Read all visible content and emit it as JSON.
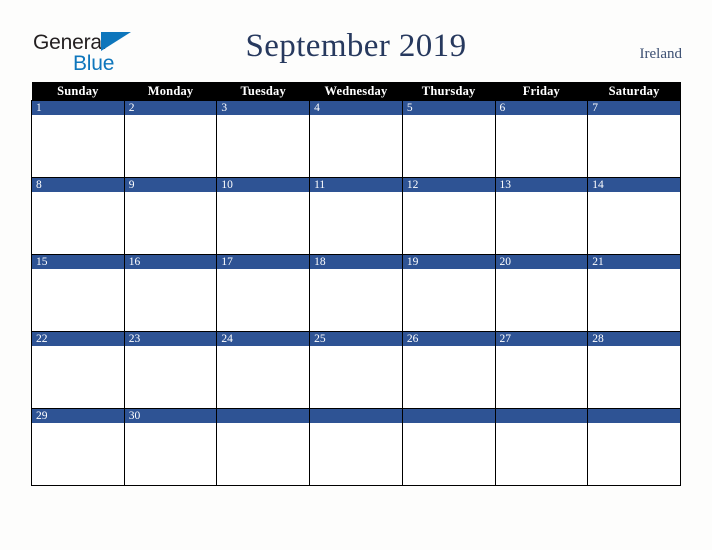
{
  "brand": {
    "name_part1": "General",
    "name_part2": "Blue",
    "triangle_color": "#0e76bc",
    "text_color": "#231f20"
  },
  "header": {
    "title": "September 2019",
    "locale": "Ireland",
    "title_color": "#27395e"
  },
  "calendar": {
    "month": "September",
    "year": "2019",
    "weekday_headers": [
      "Sunday",
      "Monday",
      "Tuesday",
      "Wednesday",
      "Thursday",
      "Friday",
      "Saturday"
    ],
    "header_bg": "#000000",
    "header_fg": "#ffffff",
    "daynum_bg": "#2e5394",
    "daynum_fg": "#ffffff",
    "cell_bg": "#ffffff",
    "border_color": "#000000",
    "weeks": [
      {
        "days": [
          {
            "num": "1"
          },
          {
            "num": "2"
          },
          {
            "num": "3"
          },
          {
            "num": "4"
          },
          {
            "num": "5"
          },
          {
            "num": "6"
          },
          {
            "num": "7"
          }
        ]
      },
      {
        "days": [
          {
            "num": "8"
          },
          {
            "num": "9"
          },
          {
            "num": "10"
          },
          {
            "num": "11"
          },
          {
            "num": "12"
          },
          {
            "num": "13"
          },
          {
            "num": "14"
          }
        ]
      },
      {
        "days": [
          {
            "num": "15"
          },
          {
            "num": "16"
          },
          {
            "num": "17"
          },
          {
            "num": "18"
          },
          {
            "num": "19"
          },
          {
            "num": "20"
          },
          {
            "num": "21"
          }
        ]
      },
      {
        "days": [
          {
            "num": "22"
          },
          {
            "num": "23"
          },
          {
            "num": "24"
          },
          {
            "num": "25"
          },
          {
            "num": "26"
          },
          {
            "num": "27"
          },
          {
            "num": "28"
          }
        ]
      },
      {
        "days": [
          {
            "num": "29"
          },
          {
            "num": "30"
          },
          {
            "num": ""
          },
          {
            "num": ""
          },
          {
            "num": ""
          },
          {
            "num": ""
          },
          {
            "num": ""
          }
        ]
      }
    ]
  },
  "page": {
    "background": "#fdfdfc"
  }
}
